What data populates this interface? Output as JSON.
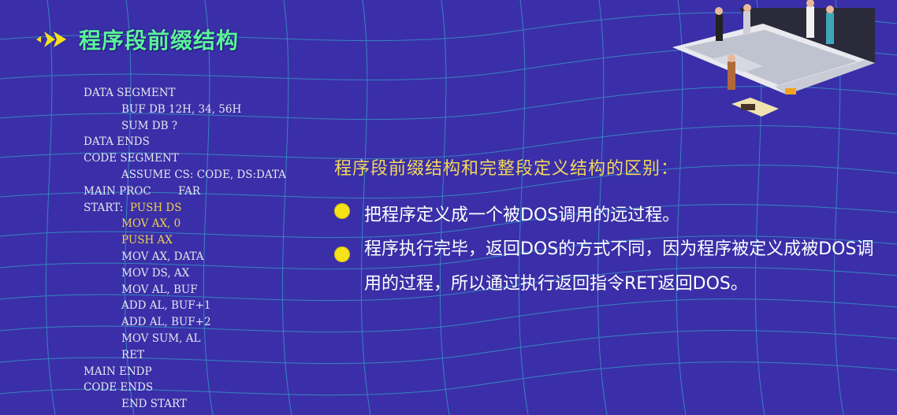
{
  "title": "程序段前缀结构",
  "code_lines": [
    {
      "text": "DATA SEGMENT",
      "indent": 0,
      "highlight": false
    },
    {
      "text": "BUF DB 12H, 34, 56H",
      "indent": 1,
      "highlight": false
    },
    {
      "text": "SUM DB ?",
      "indent": 1,
      "highlight": false
    },
    {
      "text": "DATA ENDS",
      "indent": 0,
      "highlight": false
    },
    {
      "text": "CODE SEGMENT",
      "indent": 0,
      "highlight": false
    },
    {
      "text": "ASSUME CS: CODE, DS:DATA",
      "indent": 1,
      "highlight": false
    },
    {
      "text": "MAIN PROC        FAR",
      "indent": 0,
      "highlight": false
    },
    {
      "text": "START:  PUSH DS",
      "indent": 0,
      "highlight": "partial"
    },
    {
      "text": "MOV AX, 0",
      "indent": 1,
      "highlight": true
    },
    {
      "text": "PUSH AX",
      "indent": 1,
      "highlight": true
    },
    {
      "text": "MOV AX, DATA",
      "indent": 1,
      "highlight": false
    },
    {
      "text": "MOV DS, AX",
      "indent": 1,
      "highlight": false
    },
    {
      "text": "MOV AL, BUF",
      "indent": 1,
      "highlight": false
    },
    {
      "text": "ADD AL, BUF+1",
      "indent": 1,
      "highlight": false
    },
    {
      "text": "ADD AL, BUF+2",
      "indent": 1,
      "highlight": false
    },
    {
      "text": "MOV SUM, AL",
      "indent": 1,
      "highlight": false
    },
    {
      "text": "RET",
      "indent": 1,
      "highlight": false
    },
    {
      "text": "MAIN ENDP",
      "indent": 0,
      "highlight": false
    },
    {
      "text": "CODE ENDS",
      "indent": 0,
      "highlight": false
    },
    {
      "text": "END START",
      "indent": 1,
      "highlight": false
    }
  ],
  "subtitle": "程序段前缀结构和完整段定义结构的区别：",
  "bullets": [
    "把程序定义成一个被DOS调用的远过程。",
    "程序执行完毕，返回DOS的方式不同，因为程序被定义成被DOS调用的过程，所以通过执行返回指令RET返回DOS。"
  ],
  "colors": {
    "background": "#3a2fa8",
    "title": "#5cf29a",
    "subtitle": "#f4d75a",
    "code": "#e6e6ef",
    "code_highlight": "#f1d24a",
    "bullet_dot": "#f7e21a",
    "arrow": "#f7e21a"
  },
  "icons": {
    "title_marker": "double-arrow-icon",
    "illustration": "laptop-people-illustration",
    "bullet": "yellow-dot-icon"
  }
}
